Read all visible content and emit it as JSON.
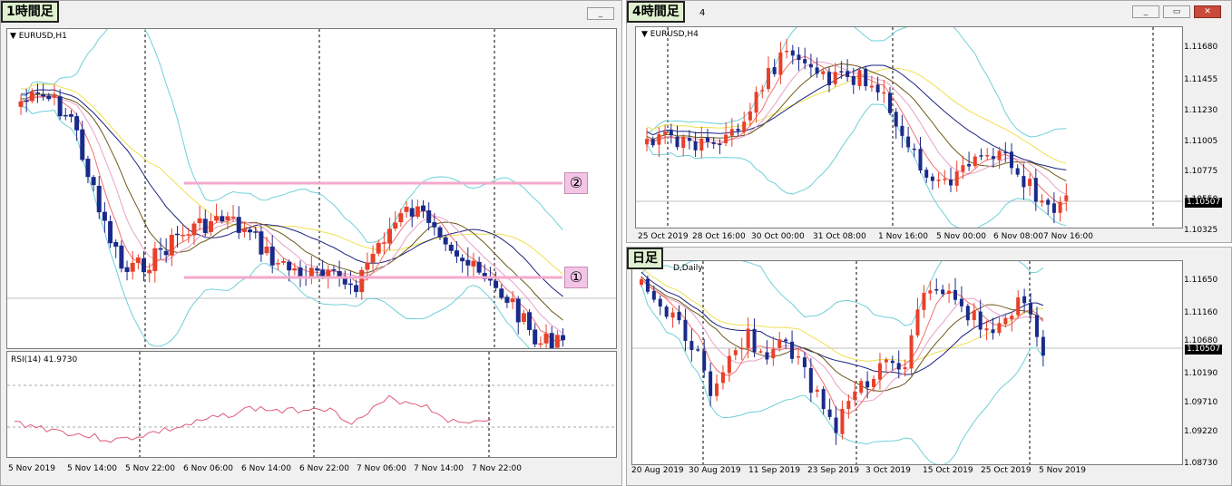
{
  "windows": {
    "h1": {
      "tag": "1時間足",
      "symbol": "EURUSD,H1",
      "rsi_label": "RSI(14) 41.9730",
      "time_labels": [
        "5 Nov 2019",
        "5 Nov 14:00",
        "5 Nov 22:00",
        "6 Nov 06:00",
        "6 Nov 14:00",
        "6 Nov 22:00",
        "7 Nov 06:00",
        "7 Nov 14:00",
        "7 Nov 22:00"
      ],
      "markers": [
        {
          "label": "②"
        },
        {
          "label": "①"
        }
      ]
    },
    "h4": {
      "tag": "4時間足",
      "symbol": "EURUSD,H4",
      "title_suffix": "4",
      "price_labels": [
        "1.11680",
        "1.11455",
        "1.11230",
        "1.11005",
        "1.10775",
        "1.10550",
        "1.10325"
      ],
      "current_price": "1.10507",
      "time_labels": [
        "25 Oct 2019",
        "28 Oct 16:00",
        "30 Oct 00:00",
        "31 Oct 08:00",
        "1 Nov 16:00",
        "5 Nov 00:00",
        "6 Nov 08:00",
        "7 Nov 16:00"
      ]
    },
    "daily": {
      "tag": "日足",
      "symbol": "D,Daily",
      "price_labels": [
        "1.11650",
        "1.11160",
        "1.10680",
        "1.10190",
        "1.09710",
        "1.09220",
        "1.08730"
      ],
      "current_price": "1.10507",
      "time_labels": [
        "20 Aug 2019",
        "30 Aug 2019",
        "11 Sep 2019",
        "23 Sep 2019",
        "3 Oct 2019",
        "15 Oct 2019",
        "25 Oct 2019",
        "5 Nov 2019"
      ]
    }
  },
  "buttons": {
    "minimize": "_",
    "restore": "▭",
    "close": "✕"
  },
  "colors": {
    "bull": "#e8402a",
    "bear": "#1a2a8a",
    "ma_yellow": "#f0e050",
    "ma_navy": "#1a237e",
    "ma_olive": "#6b5a1a",
    "ma_pink": "#e8a0c8",
    "ma_red": "#f07070",
    "bollinger": "#6fd0d8",
    "rsi": "#e05a78",
    "level_line": "#f4a8cc"
  },
  "icons": {
    "dropdown": "triangle-down-icon"
  }
}
